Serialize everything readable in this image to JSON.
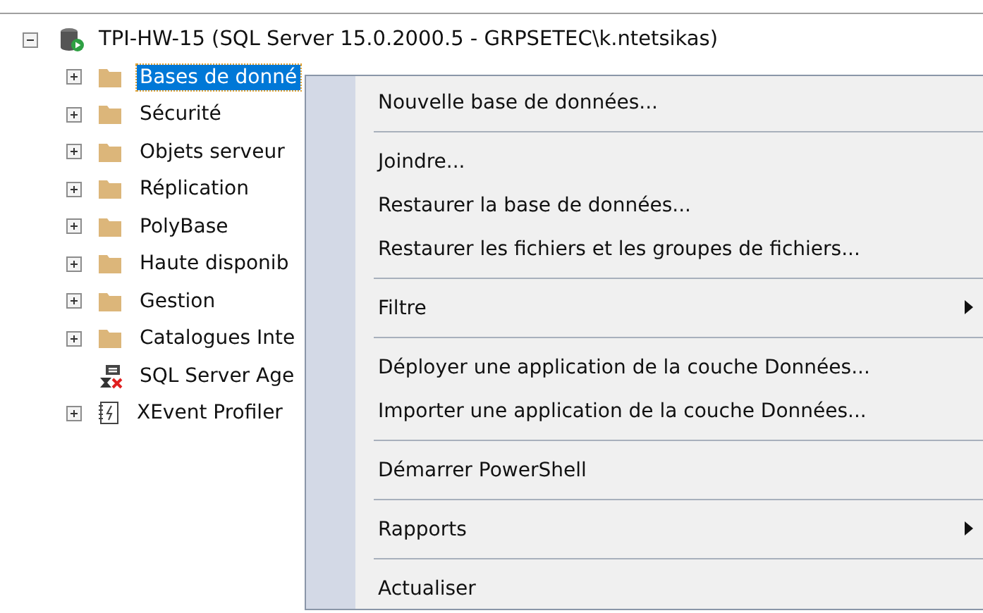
{
  "tree": {
    "label": "TPI-HW-15 (SQL Server 15.0.2000.5 - GRPSETEC\\k.ntetsikas)",
    "kind": "server",
    "expanded": true,
    "children": [
      {
        "label": "Bases de donné",
        "kind": "folder",
        "expanded": false,
        "selected": true
      },
      {
        "label": "Sécurité",
        "kind": "folder",
        "expanded": false,
        "selected": false
      },
      {
        "label": "Objets serveur",
        "kind": "folder",
        "expanded": false,
        "selected": false
      },
      {
        "label": "Réplication",
        "kind": "folder",
        "expanded": false,
        "selected": false
      },
      {
        "label": "PolyBase",
        "kind": "folder",
        "expanded": false,
        "selected": false
      },
      {
        "label": "Haute disponib",
        "kind": "folder",
        "expanded": false,
        "selected": false
      },
      {
        "label": "Gestion",
        "kind": "folder",
        "expanded": false,
        "selected": false
      },
      {
        "label": "Catalogues Inte",
        "kind": "folder",
        "expanded": false,
        "selected": false
      },
      {
        "label": "SQL Server Age",
        "kind": "agent",
        "selected": false
      },
      {
        "label": "XEvent Profiler",
        "kind": "xevent",
        "expanded": false,
        "selected": false
      }
    ]
  },
  "context_menu": [
    {
      "kind": "item",
      "label": "Nouvelle base de données...",
      "submenu": false
    },
    {
      "kind": "separator"
    },
    {
      "kind": "item",
      "label": "Joindre...",
      "submenu": false
    },
    {
      "kind": "item",
      "label": "Restaurer la base de données...",
      "submenu": false
    },
    {
      "kind": "item",
      "label": "Restaurer les fichiers et les groupes de fichiers...",
      "submenu": false
    },
    {
      "kind": "separator"
    },
    {
      "kind": "item",
      "label": "Filtre",
      "submenu": true
    },
    {
      "kind": "separator"
    },
    {
      "kind": "item",
      "label": "Déployer une application de la couche Données...",
      "submenu": false
    },
    {
      "kind": "item",
      "label": "Importer une application de la couche Données...",
      "submenu": false
    },
    {
      "kind": "separator"
    },
    {
      "kind": "item",
      "label": "Démarrer PowerShell",
      "submenu": false
    },
    {
      "kind": "separator"
    },
    {
      "kind": "item",
      "label": "Rapports",
      "submenu": true
    },
    {
      "kind": "separator"
    },
    {
      "kind": "item",
      "label": "Actualiser",
      "submenu": false
    }
  ]
}
